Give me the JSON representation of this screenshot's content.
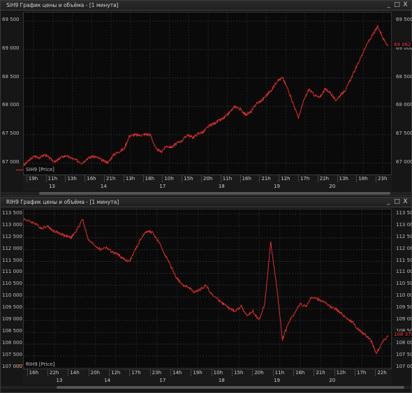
{
  "accent_color": "#e03030",
  "windows": [
    {
      "title": "SiH9 График цены и объёма - [1 минута]",
      "controls": [
        "_",
        "□",
        "X"
      ],
      "y_ticks": [
        "69 500",
        "69 000",
        "68 500",
        "68 000",
        "67 500",
        "67 000"
      ],
      "right_ticks": [
        "69 500",
        "69 000",
        "68 500",
        "68 000",
        "67 500",
        "67 000"
      ],
      "last_price": "69 062",
      "legend": "SiH9 [Price]",
      "time_ticks": [
        "19h",
        "11h",
        "13h",
        "16h",
        "21h",
        "13h",
        "18h",
        "10h",
        "15h",
        "20h",
        "11h",
        "16h",
        "21h",
        "12h",
        "17h",
        "22h",
        "13h",
        "18h",
        "23h"
      ],
      "day_ticks": [
        "13",
        "14",
        "17",
        "18",
        "19",
        "20"
      ]
    },
    {
      "title": "RIH9 График цены и объёма - [1 минута]",
      "controls": [
        "_",
        "□",
        "X"
      ],
      "y_ticks": [
        "113 500",
        "113 000",
        "112 500",
        "112 000",
        "111 500",
        "111 000",
        "110 500",
        "110 000",
        "109 500",
        "109 000",
        "108 500",
        "108 000",
        "107 500",
        "107 000"
      ],
      "right_ticks": [
        "113 500",
        "113 000",
        "112 500",
        "112 000",
        "111 500",
        "111 000",
        "110 500",
        "110 000",
        "109 500",
        "109 000",
        "108 500",
        "108 000",
        "107 500",
        "107 000"
      ],
      "last_price": "108 370",
      "legend": "RIH9 [Price]",
      "time_ticks": [
        "16h",
        "22h",
        "14h",
        "20h",
        "12h",
        "17h",
        "23h",
        "14h",
        "19h",
        "10h",
        "15h",
        "20h",
        "11h",
        "16h",
        "21h",
        "12h",
        "17h",
        "22h"
      ],
      "day_ticks": [
        "13",
        "14",
        "17",
        "18",
        "19",
        "20"
      ]
    }
  ],
  "chart_data": [
    {
      "type": "line",
      "title": "SiH9 График цены и объёма - [1 минута]",
      "series": [
        {
          "name": "SiH9 [Price]",
          "values": [
            66960,
            67050,
            67120,
            67100,
            67150,
            67080,
            67020,
            67100,
            67130,
            67090,
            67050,
            67000,
            67080,
            67120,
            67100,
            67040,
            67010,
            67150,
            67200,
            67250,
            67480,
            67500,
            67490,
            67510,
            67500,
            67250,
            67200,
            67300,
            67280,
            67350,
            67400,
            67500,
            67450,
            67520,
            67550,
            67650,
            67700,
            67750,
            67800,
            67900,
            68000,
            67950,
            67850,
            67900,
            68050,
            68100,
            68200,
            68300,
            68450,
            68500,
            68300,
            68050,
            67800,
            68100,
            68300,
            68200,
            68150,
            68300,
            68250,
            68100,
            68200,
            68300,
            68500,
            68700,
            68900,
            69100,
            69250,
            69400,
            69200,
            69062
          ]
        }
      ],
      "ylim": [
        66800,
        69650
      ]
    },
    {
      "type": "line",
      "title": "RIH9 График цены и объёма - [1 минута]",
      "series": [
        {
          "name": "RIH9 [Price]",
          "values": [
            113300,
            113200,
            113100,
            112900,
            113000,
            112800,
            112700,
            112600,
            112500,
            112800,
            113300,
            112400,
            112200,
            112000,
            112100,
            111900,
            111800,
            111600,
            111500,
            112000,
            112500,
            112800,
            112700,
            112300,
            111800,
            111300,
            110800,
            110500,
            110400,
            110200,
            110300,
            110500,
            110100,
            109900,
            109700,
            109500,
            109400,
            109600,
            109200,
            109400,
            109000,
            109700,
            112300,
            110500,
            108200,
            108900,
            109300,
            109700,
            109600,
            110000,
            109900,
            109800,
            109600,
            109500,
            109300,
            109100,
            108900,
            108600,
            108400,
            108200,
            107600,
            108100,
            108370
          ]
        }
      ],
      "ylim": [
        106850,
        113700
      ]
    }
  ]
}
